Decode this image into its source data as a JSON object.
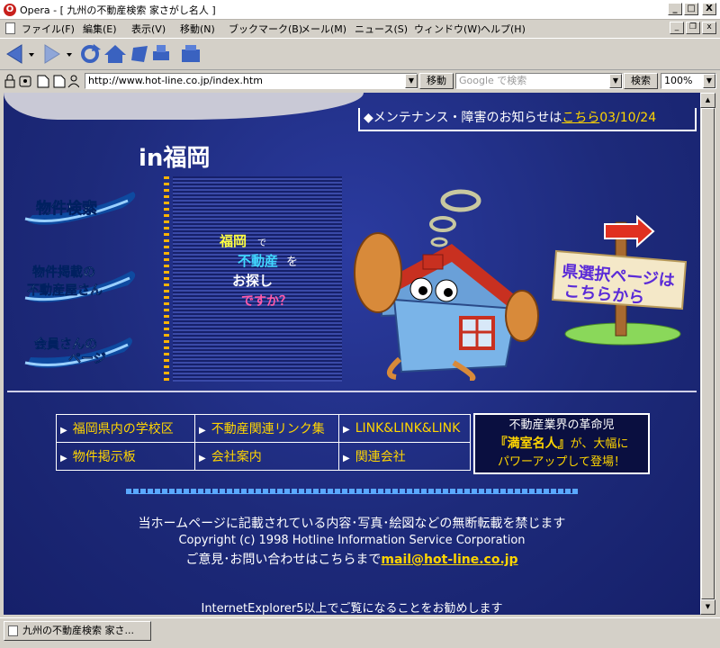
{
  "window": {
    "app": "Opera",
    "title": "Opera - [ 九州の不動産検索 家さがし名人 ]",
    "min": "_",
    "max": "□",
    "close": "X"
  },
  "menu": {
    "items": [
      "ファイル(F)",
      "編集(E)",
      "表示(V)",
      "移動(N)",
      "ブックマーク(B)",
      "メール(M)",
      "ニュース(S)",
      "ウィンドウ(W)",
      "ヘルプ(H)"
    ]
  },
  "address": {
    "url": "http://www.hot-line.co.jp/index.htm",
    "go_label": "移動",
    "search_placeholder": "Google で検索",
    "search_label": "検索",
    "zoom": "100%"
  },
  "page": {
    "notice_prefix": "◆メンテナンス・障害のお知らせは",
    "notice_link": "こちら",
    "notice_date": "03/10/24",
    "region": "in福岡",
    "nav": [
      "物件検索",
      "物件掲載の",
      "不動産屋さん",
      "会員さんの",
      "ページ"
    ],
    "banner_lines": [
      "福岡",
      "で",
      "不動産",
      "を",
      "お探し",
      "ですか？"
    ],
    "sign_lines": [
      "県選択ページは",
      "こちらから"
    ],
    "links": [
      [
        "福岡県内の学校区",
        "不動産関連リンク集",
        "LINK&LINK&LINK"
      ],
      [
        "物件掲示板",
        "会社案内",
        "関連会社"
      ]
    ],
    "promo_line1": "不動産業界の革命児",
    "promo_line2": "『満室名人』",
    "promo_line2b": "が、大幅に",
    "promo_line3": "パワーアップして登場！",
    "footer_notice": "当ホームページに記載されている内容･写真･絵図などの無断転載を禁じます",
    "copyright": "Copyright (c) 1998 Hotline Information Service Corporation",
    "contact_prefix": "ご意見･お問い合わせはこちらまで",
    "email": "mail@hot-line.co.jp",
    "browser_note": "InternetExplorer5以上でご覧になることをお勧めします"
  },
  "status": {
    "tab_title": "九州の不動産検索 家さ..."
  },
  "colors": {
    "page_bg": "#1d2a7a",
    "link_yellow": "#ffd500",
    "chrome": "#d4d0c8"
  }
}
